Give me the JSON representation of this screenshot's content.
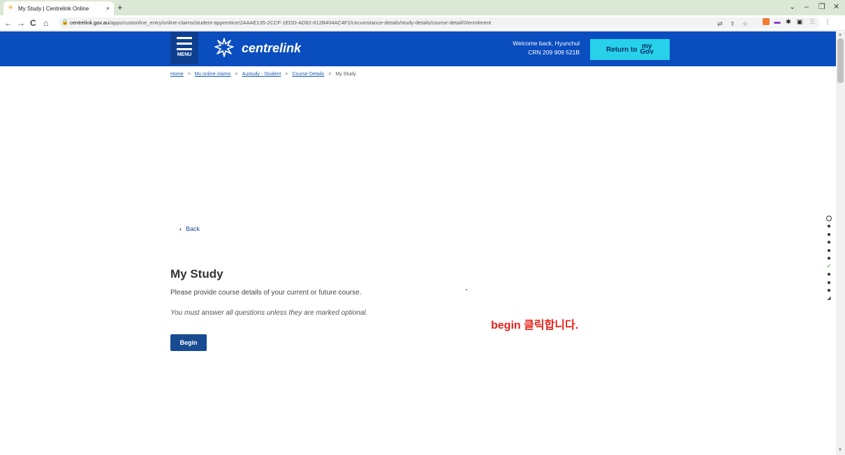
{
  "browser": {
    "tab_title": "My Study | Centrelink Online",
    "tab_close": "×",
    "new_tab": "+",
    "url_host": "centrelink.gov.au",
    "url_path": "/apps/custonline_entry/online-claims/student-apprentice/2AAAE135-2CCF-1EDD-AD82-612B404AC4F2/circumstance-details/study-details/course-detail/0/enrolment",
    "back": "←",
    "forward": "→",
    "reload": "C",
    "home": "⌂"
  },
  "header": {
    "menu_label": "MENU",
    "brand": "centrelink",
    "welcome_line1": "Welcome back, Hyunchul",
    "welcome_line2": "CRN 209 909 521B",
    "return_label": "Return to",
    "mygov_top": "my",
    "mygov_bottom": "Gov"
  },
  "breadcrumb": {
    "items": [
      "Home",
      "My online claims",
      "Austudy - Student",
      "Course Details"
    ],
    "current": "My Study",
    "separator": ">"
  },
  "main": {
    "back_label": "Back",
    "back_chevron": "‹",
    "title": "My Study",
    "intro": "Please provide course details of your current or future course.",
    "note": "You must answer all questions unless they are marked optional.",
    "begin_label": "Begin",
    "annotation": "begin 클릭합니다."
  },
  "progress": {
    "steps": [
      "current",
      "done",
      "done",
      "done",
      "done",
      "done",
      "check",
      "done",
      "done",
      "done",
      "submit"
    ]
  },
  "colors": {
    "header_bg": "#0a4dbe",
    "return_btn": "#27d1e9",
    "begin_btn": "#184b92",
    "annotation": "#e8211b",
    "tabbar": "#dbe8d5"
  }
}
